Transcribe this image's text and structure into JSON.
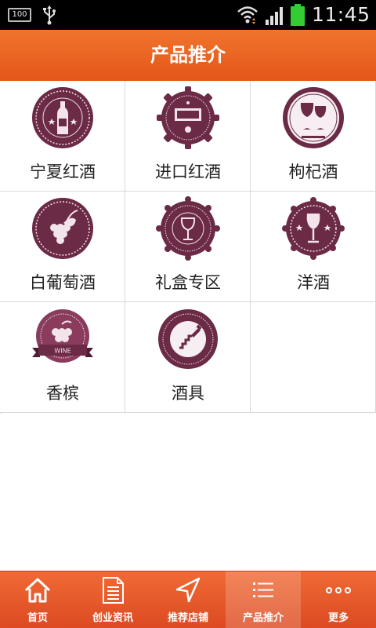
{
  "status_bar": {
    "battery_level": "100",
    "time": "11:45"
  },
  "header": {
    "title": "产品推介"
  },
  "products": [
    {
      "label": "宁夏红酒",
      "icon": "wine-bottle-badge-icon"
    },
    {
      "label": "进口红酒",
      "icon": "taste-badge-icon"
    },
    {
      "label": "枸杞酒",
      "icon": "wine-glasses-badge-icon"
    },
    {
      "label": "白葡萄酒",
      "icon": "grapes-badge-icon"
    },
    {
      "label": "礼盒专区",
      "icon": "wine-glass-badge-icon"
    },
    {
      "label": "洋酒",
      "icon": "star-wine-glass-badge-icon"
    },
    {
      "label": "香槟",
      "icon": "wine-ribbon-badge-icon",
      "badge_text": "WINE"
    },
    {
      "label": "酒具",
      "icon": "corkscrew-badge-icon"
    }
  ],
  "bottom_nav": {
    "items": [
      {
        "label": "首页",
        "icon": "home-icon"
      },
      {
        "label": "创业资讯",
        "icon": "document-icon"
      },
      {
        "label": "推荐店铺",
        "icon": "navigation-arrow-icon"
      },
      {
        "label": "产品推介",
        "icon": "list-icon",
        "active": true
      },
      {
        "label": "更多",
        "icon": "more-dots-icon"
      }
    ]
  },
  "colors": {
    "accent": "#e85c20",
    "badge": "#6b2a45",
    "badge_light": "#8a3b5e"
  }
}
